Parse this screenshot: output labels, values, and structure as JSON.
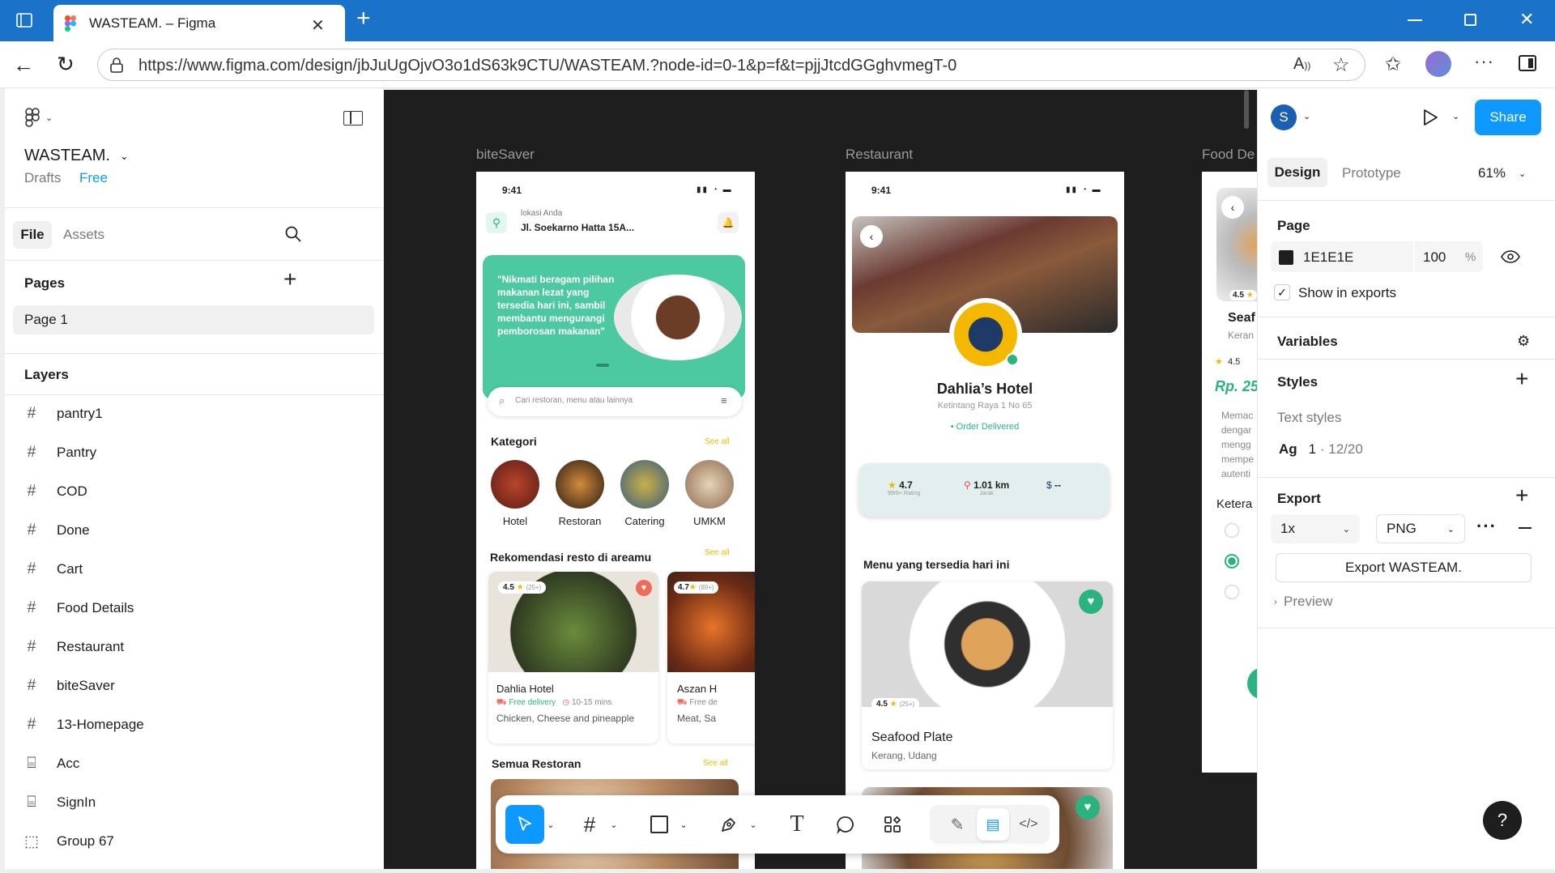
{
  "browser": {
    "tab_title": "WASTEAM. – Figma",
    "url": "https://www.figma.com/design/jbJuUgOjvO3o1dS63k9CTU/WASTEAM.?node-id=0-1&p=f&t=pjjJtcdGGghvmegT-0"
  },
  "left_panel": {
    "file_name": "WASTEAM.",
    "drafts": "Drafts",
    "plan": "Free",
    "tabs": [
      "File",
      "Assets"
    ],
    "pages_title": "Pages",
    "pages": [
      "Page 1"
    ],
    "layers_title": "Layers",
    "layers": [
      {
        "name": "pantry1",
        "icon": "frame-icon"
      },
      {
        "name": "Pantry",
        "icon": "frame-icon"
      },
      {
        "name": "COD",
        "icon": "frame-icon"
      },
      {
        "name": "Done",
        "icon": "frame-icon"
      },
      {
        "name": "Cart",
        "icon": "frame-icon"
      },
      {
        "name": "Food Details",
        "icon": "frame-icon"
      },
      {
        "name": "Restaurant",
        "icon": "frame-icon"
      },
      {
        "name": "biteSaver",
        "icon": "frame-icon"
      },
      {
        "name": "13-Homepage",
        "icon": "frame-icon"
      },
      {
        "name": "Acc",
        "icon": "component-icon"
      },
      {
        "name": "SignIn",
        "icon": "component-icon"
      },
      {
        "name": "Group 67",
        "icon": "group-icon"
      }
    ]
  },
  "canvas": {
    "frame_labels": [
      "biteSaver",
      "Restaurant",
      "Food De"
    ],
    "bitesaver": {
      "time": "9:41",
      "location_label": "lokasi Anda",
      "location_value": "Jl. Soekarno Hatta 15A...",
      "banner_text": "\"Nikmati beragam pilihan makanan lezat yang tersedia hari ini, sambil membantu mengurangi pemborosan makanan\"",
      "search_placeholder": "Cari restoran, menu atau lainnya",
      "kategori_title": "Kategori",
      "see_all": "See all",
      "categories": [
        "Hotel",
        "Restoran",
        "Catering",
        "UMKM"
      ],
      "rekomendasi_title": "Rekomendasi resto di areamu",
      "card1": {
        "rating": "4.5",
        "reviews": "(25+)",
        "name": "Dahlia Hotel",
        "delivery": "Free delivery",
        "time": "10-15 mins",
        "desc": "Chicken, Cheese and pineapple"
      },
      "card2": {
        "rating": "4.7",
        "reviews": "(89+)",
        "name": "Aszan H",
        "delivery": "Free de",
        "desc": "Meat, Sa"
      },
      "semua_title": "Semua Restoran"
    },
    "restaurant": {
      "time": "9:41",
      "name": "Dahlia’s Hotel",
      "address": "Ketintang Raya 1 No 65",
      "status": "Order Delivered",
      "rating": "4.7",
      "rating_sub": "99rb+ Rating",
      "distance": "1.01 km",
      "distance_sub": "Jarak",
      "price": "--",
      "menu_title": "Menu yang tersedia hari ini",
      "dish": {
        "rating": "4.5",
        "reviews": "(25+)",
        "name": "Seafood Plate",
        "desc": "Kerang, Udang"
      }
    },
    "food_details": {
      "rating": "4.5",
      "name": "Seaf",
      "desc": "Keran",
      "rating2": "4.5",
      "price": "Rp. 25",
      "text_lines": [
        "Memac",
        "dengar",
        "mengg",
        "mempe",
        "autenti"
      ],
      "ketera": "Ketera"
    }
  },
  "right_panel": {
    "avatar": "S",
    "share": "Share",
    "tabs": [
      "Design",
      "Prototype"
    ],
    "zoom": "61%",
    "page_title": "Page",
    "page_color": "1E1E1E",
    "page_opacity": "100",
    "percent": "%",
    "show_in_exports": "Show in exports",
    "variables": "Variables",
    "styles": "Styles",
    "text_styles": "Text styles",
    "text_style_sample": "Ag",
    "text_style_name": "1",
    "text_style_size": "· 12/20",
    "export": "Export",
    "export_scale": "1x",
    "export_format": "PNG",
    "export_button": "Export WASTEAM.",
    "preview": "Preview",
    "help": "?"
  },
  "colors": {
    "browser_blue": "#1a73c8",
    "figma_blue": "#0d99ff",
    "teal": "#4cc9a0",
    "canvas_bg": "#1e1e1e",
    "page_color": "#1E1E1E"
  }
}
